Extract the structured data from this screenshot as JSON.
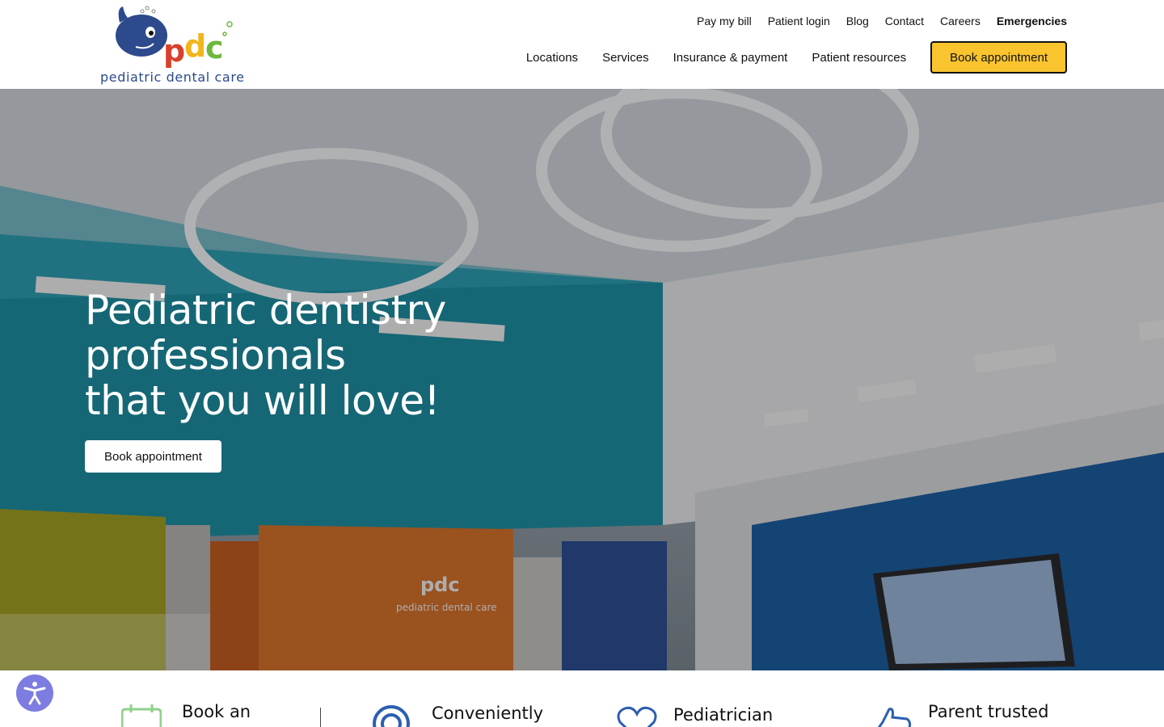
{
  "brand": {
    "name": "pediatric dental care",
    "colors": {
      "blue": "#2c4a8c",
      "red": "#d9402b",
      "yellow": "#f2b51d",
      "green": "#6bb83d",
      "accent_button": "#f9c42e"
    }
  },
  "utility_nav": [
    "Pay my bill",
    "Patient login",
    "Blog",
    "Contact",
    "Careers",
    "Emergencies"
  ],
  "main_nav": [
    "Locations",
    "Services",
    "Insurance & payment",
    "Patient resources"
  ],
  "header_cta": "Book appointment",
  "hero": {
    "title_lines": [
      "Pediatric dentistry",
      "professionals",
      "that you will love!"
    ],
    "cta": "Book appointment",
    "sign": {
      "logo": "pdc",
      "name": "pediatric dental care"
    }
  },
  "features": [
    {
      "label": "Book an",
      "icon": "calendar-icon"
    },
    {
      "label": "Conveniently",
      "icon": "location-pin-icon"
    },
    {
      "label": "Pediatrician",
      "icon": "heart-icon"
    },
    {
      "label": "Parent trusted",
      "icon": "thumbs-up-icon"
    }
  ],
  "accessibility_icon": "accessibility-icon"
}
